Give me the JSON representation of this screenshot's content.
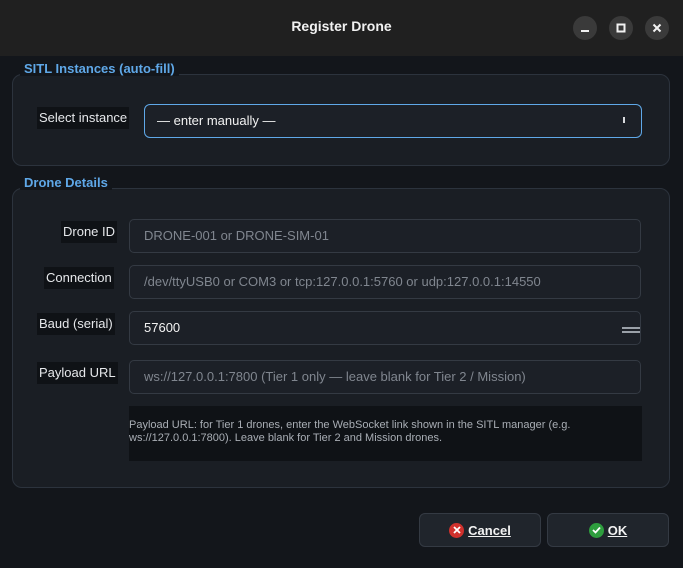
{
  "window": {
    "title": "Register Drone",
    "controls": [
      "minimize-icon",
      "maximize-icon",
      "close-icon"
    ]
  },
  "sitl_group": {
    "title": "SITL Instances (auto-fill)",
    "select_label": "Select instance",
    "select_value": "— enter manually —"
  },
  "details_group": {
    "title": "Drone Details",
    "drone_id": {
      "label": "Drone ID",
      "placeholder": "DRONE-001 or DRONE-SIM-01"
    },
    "connection": {
      "label": "Connection",
      "placeholder": "/dev/ttyUSB0 or COM3 or tcp:127.0.0.1:5760 or udp:127.0.0.1:14550"
    },
    "baud": {
      "label": "Baud (serial)",
      "value": "57600"
    },
    "payload_url": {
      "label": "Payload URL",
      "placeholder": "ws://127.0.0.1:7800  (Tier 1 only — leave blank for Tier 2 / Mission)"
    },
    "help_text": "Payload URL: for Tier 1 drones, enter the WebSocket link shown in the SITL manager (e.g. ws://127.0.0.1:7800). Leave blank for Tier 2 and Mission drones."
  },
  "buttons": {
    "cancel": "Cancel",
    "ok": "OK"
  },
  "colors": {
    "accent": "#5fa8e8",
    "cancel_icon": "#d0312d",
    "ok_icon": "#2e9e3e"
  }
}
